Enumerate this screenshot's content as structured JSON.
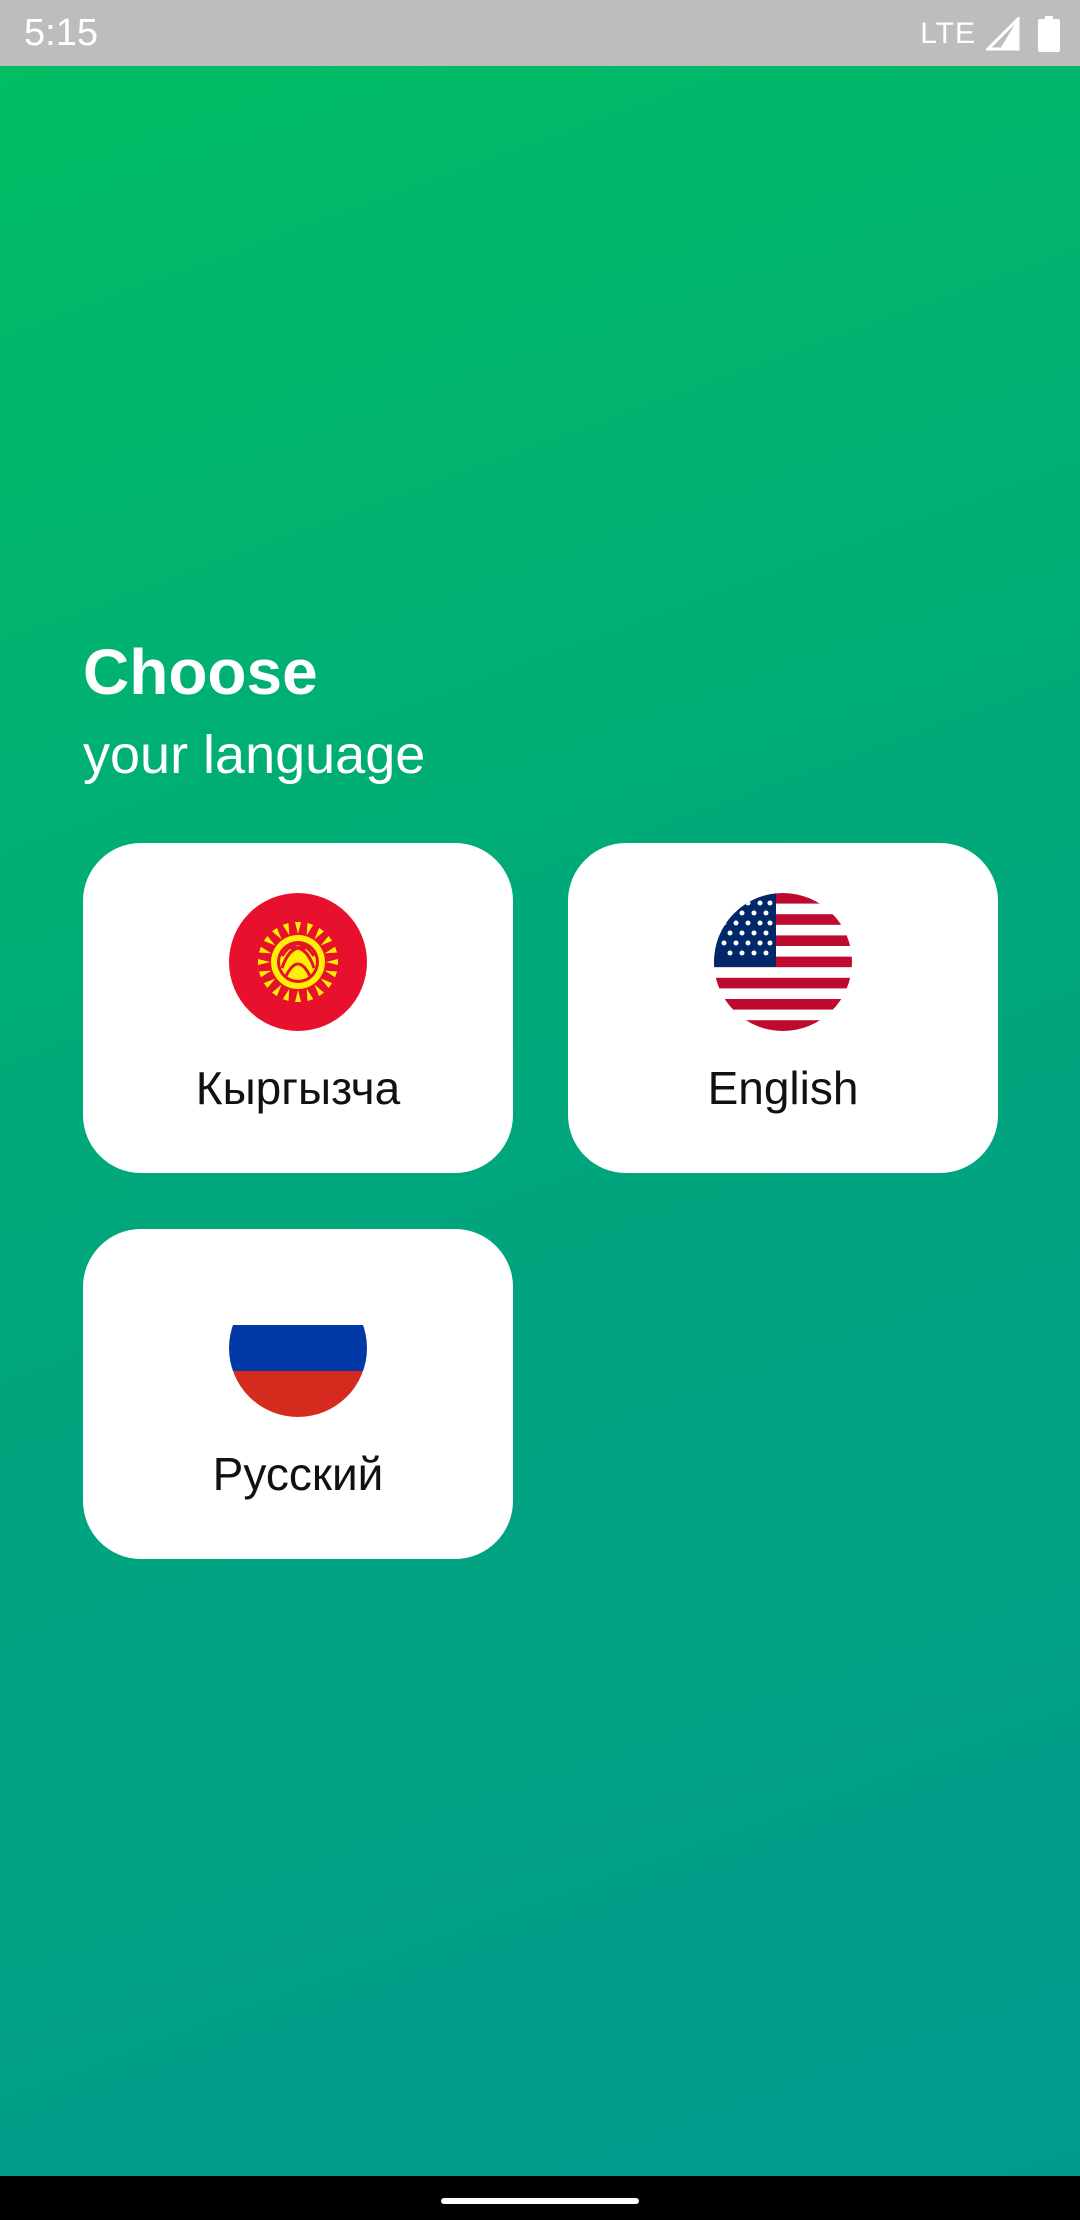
{
  "status_bar": {
    "time": "5:15",
    "network": "LTE"
  },
  "heading": "Choose",
  "subheading": "your language",
  "languages": [
    {
      "label": "Кыргызча",
      "flag": "kyrgyzstan-flag-icon"
    },
    {
      "label": "English",
      "flag": "usa-flag-icon"
    },
    {
      "label": "Русский",
      "flag": "russia-flag-icon"
    }
  ],
  "colors": {
    "gradient_top": "#00bf63",
    "gradient_bottom": "#009a8e",
    "card": "#ffffff",
    "status_bar": "#bdbdbd"
  }
}
